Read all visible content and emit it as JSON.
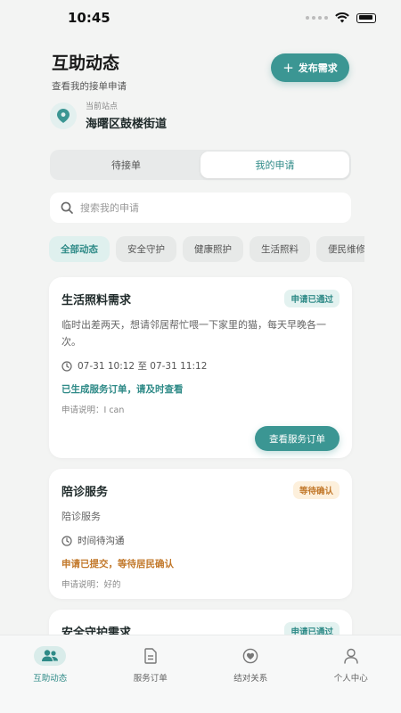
{
  "status_bar": {
    "time": "10:45"
  },
  "header": {
    "title": "互助动态",
    "subtitle": "查看我的接单申请",
    "publish_label": "发布需求"
  },
  "station": {
    "label": "当前站点",
    "name": "海曙区鼓楼街道"
  },
  "tabs": [
    {
      "label": "待接单",
      "active": false
    },
    {
      "label": "我的申请",
      "active": true
    }
  ],
  "search": {
    "placeholder": "搜索我的申请",
    "value": ""
  },
  "chips": [
    {
      "label": "全部动态",
      "active": true
    },
    {
      "label": "安全守护",
      "active": false
    },
    {
      "label": "健康照护",
      "active": false
    },
    {
      "label": "生活照料",
      "active": false
    },
    {
      "label": "便民维修",
      "active": false
    }
  ],
  "cards": [
    {
      "title": "生活照料需求",
      "badge": "申请已通过",
      "desc": "临时出差两天，想请邻居帮忙喂一下家里的猫，每天早晚各一次。",
      "time": "07-31 10:12 至 07-31 11:12",
      "status": "已生成服务订单，请及时查看",
      "note": "申请说明：I can",
      "action": "查看服务订单"
    },
    {
      "title": "陪诊服务",
      "badge": "等待确认",
      "desc": "陪诊服务",
      "time": "时间待沟通",
      "status": "申请已提交，等待居民确认",
      "note": "申请说明：好的"
    },
    {
      "title": "安全守护需求",
      "badge": "申请已通过"
    }
  ],
  "bottom_nav": [
    {
      "label": "互助动态",
      "icon": "people-icon",
      "active": true
    },
    {
      "label": "服务订单",
      "icon": "document-icon",
      "active": false
    },
    {
      "label": "结对关系",
      "icon": "heart-badge-icon",
      "active": false
    },
    {
      "label": "个人中心",
      "icon": "person-icon",
      "active": false
    }
  ],
  "colors": {
    "accent": "#3b9693",
    "accent_text": "#2e8a87",
    "warning": "#c2782a",
    "background": "#f3f4f3"
  }
}
